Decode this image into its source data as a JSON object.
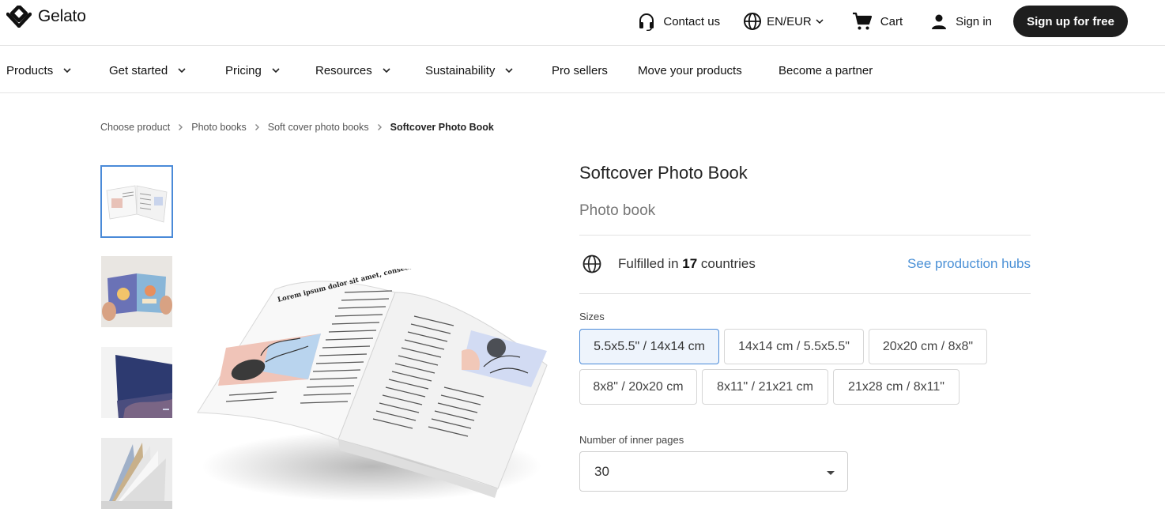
{
  "brand": {
    "name": "Gelato"
  },
  "header": {
    "contact": "Contact us",
    "locale": "EN/EUR",
    "cart": "Cart",
    "signin": "Sign in",
    "signup": "Sign up for free"
  },
  "nav": {
    "items": [
      {
        "label": "Products"
      },
      {
        "label": "Get started"
      },
      {
        "label": "Pricing"
      },
      {
        "label": "Resources"
      },
      {
        "label": "Sustainability"
      },
      {
        "label": "Pro sellers"
      },
      {
        "label": "Move your products"
      },
      {
        "label": "Become a partner"
      }
    ]
  },
  "breadcrumb": [
    "Choose product",
    "Photo books",
    "Soft cover photo books",
    "Softcover Photo Book"
  ],
  "product": {
    "title": "Softcover Photo Book",
    "subtitle": "Photo book",
    "fulfilled_prefix": "Fulfilled in ",
    "fulfilled_count": "17",
    "fulfilled_suffix": " countries",
    "hubs_link": "See production hubs"
  },
  "sizes": {
    "label": "Sizes",
    "options": [
      "5.5x5.5\" / 14x14 cm",
      "14x14 cm / 5.5x5.5\"",
      "20x20 cm / 8x8\"",
      "8x8\" / 20x20 cm",
      "8x11\" / 21x21 cm",
      "21x28 cm / 8x11\""
    ],
    "selected": "5.5x5.5\" / 14x14 cm"
  },
  "pages": {
    "label": "Number of inner pages",
    "value": "30"
  },
  "book_page_text": "Lorem ipsum dolor sit amet, consectetur adipiscing elit. Vivamus iaculis est lacus. Mauris a faucibus enim, ut ultricies est.",
  "colors": {
    "accent": "#4a8ad8",
    "link": "#4a90d6",
    "button": "#1e1e1e"
  }
}
